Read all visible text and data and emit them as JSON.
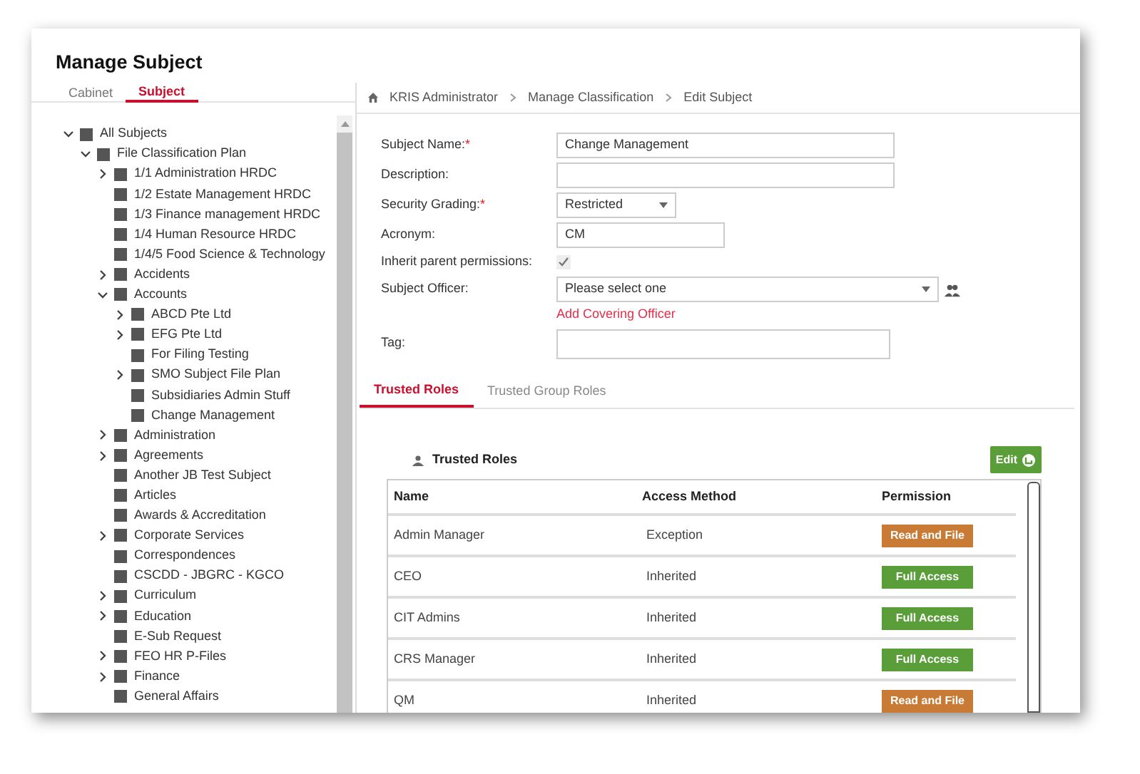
{
  "page": {
    "title": "Manage Subject"
  },
  "left_tabs": [
    {
      "label": "Cabinet",
      "selected": false
    },
    {
      "label": "Subject",
      "selected": true
    }
  ],
  "tree": [
    {
      "label": "All Subjects",
      "kind": "branch",
      "expanded": true,
      "children": [
        {
          "label": "File Classification Plan",
          "kind": "branch",
          "expanded": true,
          "children": [
            {
              "label": "1/1 Administration HRDC",
              "kind": "branch",
              "expanded": false
            },
            {
              "label": "1/2 Estate Management HRDC",
              "kind": "leaf"
            },
            {
              "label": "1/3 Finance management HRDC",
              "kind": "leaf"
            },
            {
              "label": "1/4 Human Resource HRDC",
              "kind": "leaf"
            },
            {
              "label": "1/4/5 Food Science & Technology",
              "kind": "leaf"
            },
            {
              "label": "Accidents",
              "kind": "branch",
              "expanded": false
            },
            {
              "label": "Accounts",
              "kind": "branch",
              "expanded": true,
              "children": [
                {
                  "label": "ABCD Pte Ltd",
                  "kind": "branch",
                  "expanded": false
                },
                {
                  "label": "EFG Pte Ltd",
                  "kind": "branch",
                  "expanded": false
                },
                {
                  "label": "For Filing Testing",
                  "kind": "leaf"
                },
                {
                  "label": "SMO Subject File Plan",
                  "kind": "branch",
                  "expanded": false
                },
                {
                  "label": "Subsidiaries Admin Stuff",
                  "kind": "leaf"
                },
                {
                  "label": "Change Management",
                  "kind": "leaf"
                }
              ]
            },
            {
              "label": "Administration",
              "kind": "branch",
              "expanded": false
            },
            {
              "label": "Agreements",
              "kind": "branch",
              "expanded": false
            },
            {
              "label": "Another JB Test Subject",
              "kind": "leaf"
            },
            {
              "label": "Articles",
              "kind": "leaf"
            },
            {
              "label": "Awards & Accreditation",
              "kind": "leaf"
            },
            {
              "label": "Corporate Services",
              "kind": "branch",
              "expanded": false
            },
            {
              "label": "Correspondences",
              "kind": "leaf"
            },
            {
              "label": "CSCDD - JBGRC - KGCO",
              "kind": "leaf"
            },
            {
              "label": "Curriculum",
              "kind": "branch",
              "expanded": false
            },
            {
              "label": "Education",
              "kind": "branch",
              "expanded": false
            },
            {
              "label": "E-Sub Request",
              "kind": "leaf"
            },
            {
              "label": "FEO HR P-Files",
              "kind": "branch",
              "expanded": false
            },
            {
              "label": "Finance",
              "kind": "branch",
              "expanded": false
            },
            {
              "label": "General Affairs",
              "kind": "leaf"
            }
          ]
        }
      ]
    }
  ],
  "breadcrumb": [
    "KRIS Administrator",
    "Manage Classification",
    "Edit Subject"
  ],
  "form": {
    "subject_name": {
      "label": "Subject Name:",
      "required_mark": "*",
      "value": "Change Management"
    },
    "description": {
      "label": "Description:"
    },
    "security_grading": {
      "label": "Security Grading:",
      "required_mark": "*",
      "value": "Restricted"
    },
    "acronym": {
      "label": "Acronym:",
      "value": "CM"
    },
    "inherit": {
      "label": "Inherit parent permissions:",
      "checked": true
    },
    "subject_officer": {
      "label": "Subject Officer:",
      "placeholder": "Please select one"
    },
    "add_link": "Add Covering Officer",
    "tag": {
      "label": "Tag:"
    }
  },
  "role_tabs": [
    {
      "label": "Trusted Roles",
      "selected": true
    },
    {
      "label": "Trusted Group Roles",
      "selected": false
    }
  ],
  "roles_panel": {
    "title": "Trusted Roles",
    "edit_button": "Edit",
    "columns": [
      "Name",
      "Access Method",
      "Permission"
    ],
    "rows": [
      {
        "name": "Admin Manager",
        "method": "Exception",
        "permission": "Read and File",
        "kind": "read"
      },
      {
        "name": "CEO",
        "method": "Inherited",
        "permission": "Full Access",
        "kind": "full"
      },
      {
        "name": "CIT Admins",
        "method": "Inherited",
        "permission": "Full Access",
        "kind": "full"
      },
      {
        "name": "CRS Manager",
        "method": "Inherited",
        "permission": "Full Access",
        "kind": "full"
      },
      {
        "name": "QM",
        "method": "Inherited",
        "permission": "Read and File",
        "kind": "read"
      }
    ]
  }
}
